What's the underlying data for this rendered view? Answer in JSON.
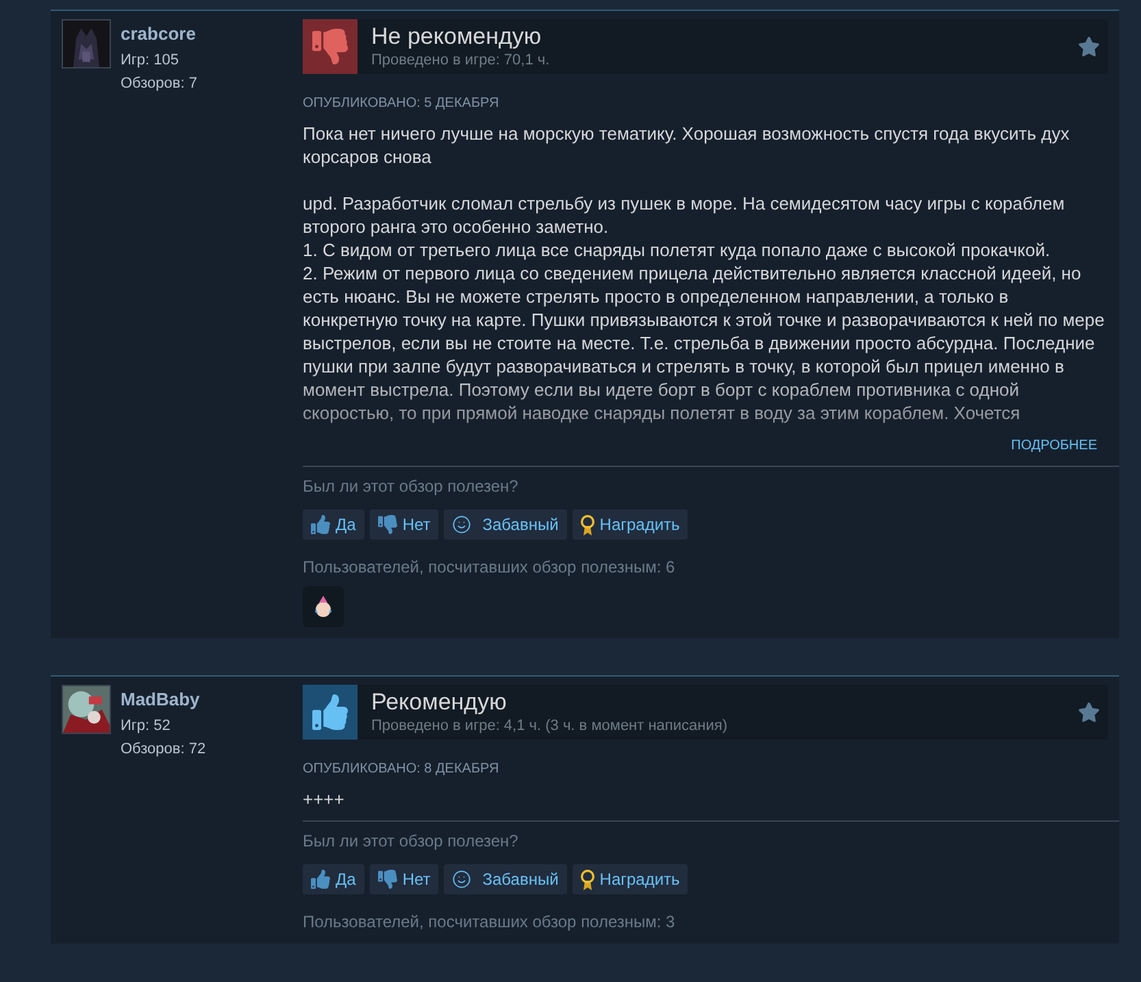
{
  "reviews": [
    {
      "author": {
        "name": "crabcore",
        "games": "Игр: 105",
        "reviews": "Обзоров: 7"
      },
      "recommended": false,
      "verdict": "Не рекомендую",
      "playtime": "Проведено в игре: 70,1 ч.",
      "posted": "ОПУБЛИКОВАНО: 5 ДЕКАБРЯ",
      "paragraphs": [
        [
          "Пока нет ничего лучше на морскую тематику. Хорошая возможность спустя года вкусить дух корсаров снова"
        ],
        [
          "upd. Разработчик сломал стрельбу из пушек в море. На семидесятом часу игры с кораблем второго ранга это особенно заметно.",
          "1. С видом от третьего лица все снаряды полетят куда попало даже с высокой прокачкой.",
          "2. Режим от первого лица со сведением прицела действительно является классной идеей, но есть нюанс. Вы не можете стрелять просто в определенном направлении, а только в конкретную точку на карте. Пушки привязываются к этой точке и разворачиваются к ней по мере выстрелов, если вы не стоите на месте. Т.е. стрельба в движении просто абсурдна. Последние пушки при залпе будут разворачиваться и стрелять в точку, в которой был прицел именно в момент выстрела. Поэтому если вы идете борт в борт с кораблем противника с одной скоростью, то при прямой наводке снаряды полетят в воду за этим кораблем. Хочется"
        ]
      ],
      "read_more": "ПОДРОБНЕЕ",
      "helpful_question": "Был ли этот обзор полезен?",
      "buttons": [
        {
          "kind": "yes",
          "label": "Да"
        },
        {
          "kind": "no",
          "label": "Нет"
        },
        {
          "kind": "funny",
          "label": "Забавный"
        },
        {
          "kind": "award",
          "label": "Наградить"
        }
      ],
      "helpful_count": "Пользователей, посчитавших обзор полезным: 6",
      "has_award": true
    },
    {
      "author": {
        "name": "MadBaby",
        "games": "Игр: 52",
        "reviews": "Обзоров: 72"
      },
      "recommended": true,
      "verdict": "Рекомендую",
      "playtime": "Проведено в игре: 4,1 ч. (3 ч. в момент написания)",
      "posted": "ОПУБЛИКОВАНО: 8 ДЕКАБРЯ",
      "paragraphs": [
        [
          "++++"
        ]
      ],
      "helpful_question": "Был ли этот обзор полезен?",
      "buttons": [
        {
          "kind": "yes",
          "label": "Да"
        },
        {
          "kind": "no",
          "label": "Нет"
        },
        {
          "kind": "funny",
          "label": "Забавный"
        },
        {
          "kind": "award",
          "label": "Наградить"
        }
      ],
      "helpful_count": "Пользователей, посчитавших обзор полезным: 3",
      "has_award": false
    }
  ]
}
